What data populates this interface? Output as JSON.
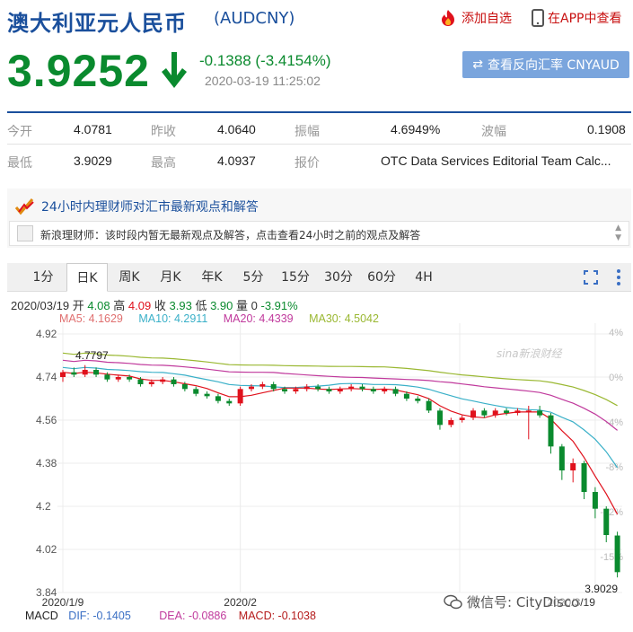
{
  "header": {
    "title": "澳大利亚元人民币",
    "code": "(AUDCNY)",
    "add_favorite": "添加自选",
    "view_in_app": "在APP中查看"
  },
  "quote": {
    "price": "3.9252",
    "change": "-0.1388 (-3.4154%)",
    "time": "2020-03-19 11:25:02",
    "reverse_button": "查看反向汇率 CNYAUD"
  },
  "stats": {
    "row1": [
      {
        "label": "今开",
        "value": "4.0781"
      },
      {
        "label": "昨收",
        "value": "4.0640"
      },
      {
        "label": "振幅",
        "value": "4.6949%"
      },
      {
        "label": "波幅",
        "value": "0.1908"
      }
    ],
    "row2": [
      {
        "label": "最低",
        "value": "3.9029"
      },
      {
        "label": "最高",
        "value": "4.0937"
      },
      {
        "label": "报价",
        "value": "OTC Data Services Editorial Team Calc..."
      }
    ]
  },
  "advisor": {
    "heading": "24小时内理财师对汇市最新观点和解答",
    "message": "新浪理财师：该时段内暂无最新观点及解答，点击查看24小时之前的观点及解答"
  },
  "tabs": [
    {
      "label": "1分",
      "active": false
    },
    {
      "label": "日K",
      "active": true
    },
    {
      "label": "周K",
      "active": false
    },
    {
      "label": "月K",
      "active": false
    },
    {
      "label": "年K",
      "active": false
    },
    {
      "label": "5分",
      "active": false
    },
    {
      "label": "15分",
      "active": false
    },
    {
      "label": "30分",
      "active": false
    },
    {
      "label": "60分",
      "active": false
    },
    {
      "label": "4H",
      "active": false
    }
  ],
  "kline_info": {
    "date": "2020/03/19",
    "open_label": "开",
    "open": "4.08",
    "high_label": "高",
    "high": "4.09",
    "close_label": "收",
    "close": "3.93",
    "low_label": "低",
    "low": "3.90",
    "vol_label": "量",
    "vol": "0",
    "pct": "-3.91%"
  },
  "ma": {
    "ma5": "MA5: 4.1629",
    "ma10": "MA10: 4.2911",
    "ma20": "MA20: 4.4339",
    "ma30": "MA30: 4.5042"
  },
  "macd": {
    "label": "MACD",
    "dif": "DIF: -0.1405",
    "dea": "DEA: -0.0886",
    "macd": "MACD: -0.1038"
  },
  "watermark": {
    "wechat": "微信号: CityDisco",
    "sina": "sina新浪财经"
  },
  "colors": {
    "up": "#e0111c",
    "down": "#0a8a2e",
    "accent": "#1a4f9c",
    "ma5": "#e0111c",
    "ma10": "#3ab0c8",
    "ma20": "#c0399c",
    "ma30": "#9ab832"
  },
  "chart_data": {
    "type": "candlestick",
    "y_ticks": [
      "4.92",
      "4.74",
      "4.56",
      "4.38",
      "4.2",
      "4.02",
      "3.84"
    ],
    "y_range": [
      3.84,
      4.92
    ],
    "pct_ticks": [
      "4%",
      "0%",
      "-4%",
      "-8%",
      "-12%",
      "-15%"
    ],
    "x_ticks": [
      "2020/1/9",
      "2020/2",
      "2020/3/19"
    ],
    "x_tick_index": [
      0,
      16,
      48
    ],
    "max_label": "4.7797",
    "min_label": "3.9029",
    "candles": [
      [
        4.74,
        4.76,
        4.77,
        4.72
      ],
      [
        4.76,
        4.75,
        4.78,
        4.74
      ],
      [
        4.75,
        4.77,
        4.79,
        4.74
      ],
      [
        4.77,
        4.75,
        4.78,
        4.74
      ],
      [
        4.75,
        4.73,
        4.76,
        4.72
      ],
      [
        4.73,
        4.74,
        4.75,
        4.72
      ],
      [
        4.74,
        4.73,
        4.75,
        4.72
      ],
      [
        4.73,
        4.71,
        4.74,
        4.7
      ],
      [
        4.71,
        4.72,
        4.73,
        4.7
      ],
      [
        4.72,
        4.73,
        4.74,
        4.71
      ],
      [
        4.73,
        4.71,
        4.74,
        4.7
      ],
      [
        4.71,
        4.69,
        4.72,
        4.68
      ],
      [
        4.69,
        4.67,
        4.7,
        4.66
      ],
      [
        4.67,
        4.66,
        4.68,
        4.65
      ],
      [
        4.66,
        4.64,
        4.67,
        4.63
      ],
      [
        4.64,
        4.63,
        4.65,
        4.62
      ],
      [
        4.63,
        4.69,
        4.7,
        4.62
      ],
      [
        4.69,
        4.7,
        4.71,
        4.68
      ],
      [
        4.7,
        4.71,
        4.72,
        4.69
      ],
      [
        4.71,
        4.69,
        4.72,
        4.68
      ],
      [
        4.69,
        4.68,
        4.7,
        4.67
      ],
      [
        4.68,
        4.69,
        4.7,
        4.67
      ],
      [
        4.69,
        4.7,
        4.71,
        4.68
      ],
      [
        4.7,
        4.69,
        4.71,
        4.68
      ],
      [
        4.69,
        4.68,
        4.7,
        4.67
      ],
      [
        4.68,
        4.69,
        4.7,
        4.67
      ],
      [
        4.69,
        4.7,
        4.71,
        4.68
      ],
      [
        4.7,
        4.69,
        4.71,
        4.68
      ],
      [
        4.69,
        4.68,
        4.7,
        4.67
      ],
      [
        4.68,
        4.69,
        4.7,
        4.67
      ],
      [
        4.69,
        4.67,
        4.7,
        4.66
      ],
      [
        4.67,
        4.65,
        4.68,
        4.64
      ],
      [
        4.65,
        4.64,
        4.66,
        4.63
      ],
      [
        4.64,
        4.6,
        4.65,
        4.59
      ],
      [
        4.6,
        4.54,
        4.61,
        4.52
      ],
      [
        4.54,
        4.56,
        4.57,
        4.53
      ],
      [
        4.56,
        4.57,
        4.58,
        4.55
      ],
      [
        4.57,
        4.6,
        4.61,
        4.56
      ],
      [
        4.6,
        4.58,
        4.61,
        4.57
      ],
      [
        4.58,
        4.6,
        4.61,
        4.57
      ],
      [
        4.6,
        4.59,
        4.61,
        4.58
      ],
      [
        4.59,
        4.6,
        4.61,
        4.58
      ],
      [
        4.6,
        4.6,
        4.62,
        4.48
      ],
      [
        4.6,
        4.58,
        4.62,
        4.57
      ],
      [
        4.58,
        4.45,
        4.59,
        4.42
      ],
      [
        4.45,
        4.35,
        4.46,
        4.31
      ],
      [
        4.35,
        4.38,
        4.4,
        4.3
      ],
      [
        4.38,
        4.26,
        4.39,
        4.23
      ],
      [
        4.26,
        4.19,
        4.28,
        4.15
      ],
      [
        4.19,
        4.08,
        4.2,
        4.05
      ],
      [
        4.078,
        3.925,
        4.094,
        3.903
      ]
    ],
    "candle_order": [
      "open",
      "close",
      "high",
      "low"
    ]
  }
}
